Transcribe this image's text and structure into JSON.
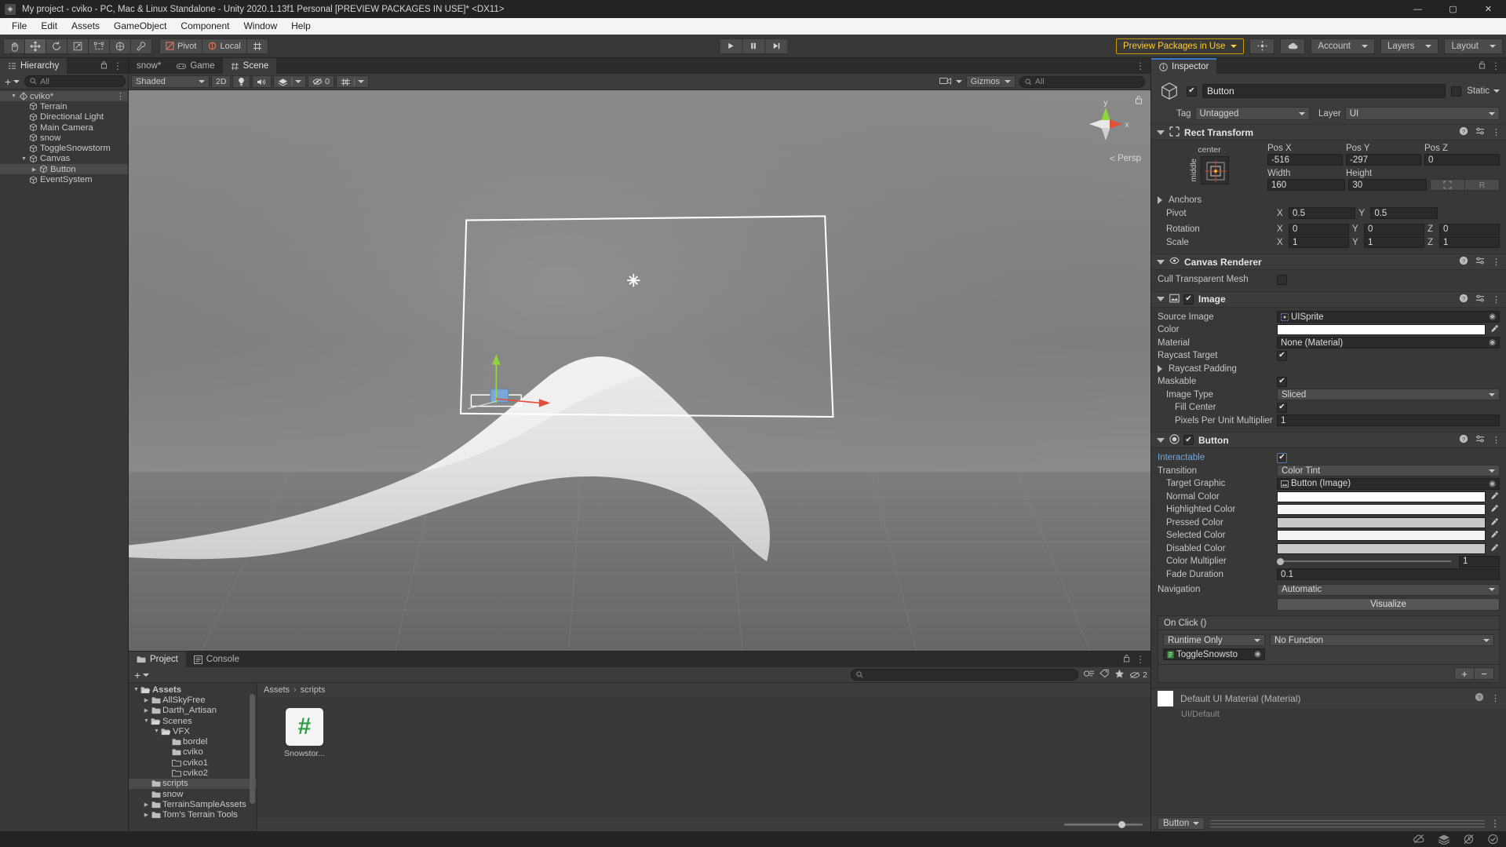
{
  "window": {
    "title": "My project - cviko - PC, Mac & Linux Standalone - Unity 2020.1.13f1 Personal [PREVIEW PACKAGES IN USE]* <DX11>",
    "minimize": "—",
    "maximize": "▢",
    "close": "✕"
  },
  "menubar": {
    "items": [
      "File",
      "Edit",
      "Assets",
      "GameObject",
      "Component",
      "Window",
      "Help"
    ]
  },
  "toolbar": {
    "tools": [
      {
        "name": "hand-tool",
        "glyph": "✋"
      },
      {
        "name": "move-tool",
        "glyph": "✥"
      },
      {
        "name": "rotate-tool",
        "glyph": "↻"
      },
      {
        "name": "scale-tool",
        "glyph": "⤢"
      },
      {
        "name": "rect-tool",
        "glyph": "▢"
      },
      {
        "name": "transform-tool",
        "glyph": "✦"
      },
      {
        "name": "custom-editor-tool",
        "glyph": "🔧"
      }
    ],
    "pivot_label": "Pivot",
    "handle_label": "Local",
    "grid_label": "#",
    "play": "▶",
    "pause": "❚❚",
    "step": "▶❙",
    "preview_packages": "Preview Packages in Use",
    "account": "Account",
    "layers": "Layers",
    "layout": "Layout"
  },
  "hierarchy": {
    "tab_label": "Hierarchy",
    "search_placeholder": "All",
    "plus_label": "+",
    "items": [
      {
        "label": "cviko*",
        "depth": 0,
        "expanded": true,
        "selected": true,
        "icon": "unity-scene-icon"
      },
      {
        "label": "Terrain",
        "depth": 1,
        "expanded": null,
        "selected": false,
        "icon": "gameobject-icon"
      },
      {
        "label": "Directional Light",
        "depth": 1,
        "expanded": null,
        "selected": false,
        "icon": "gameobject-icon"
      },
      {
        "label": "Main Camera",
        "depth": 1,
        "expanded": null,
        "selected": false,
        "icon": "gameobject-icon"
      },
      {
        "label": "snow",
        "depth": 1,
        "expanded": null,
        "selected": false,
        "icon": "gameobject-icon"
      },
      {
        "label": "ToggleSnowstorm",
        "depth": 1,
        "expanded": null,
        "selected": false,
        "icon": "gameobject-icon"
      },
      {
        "label": "Canvas",
        "depth": 1,
        "expanded": true,
        "selected": false,
        "icon": "gameobject-icon"
      },
      {
        "label": "Button",
        "depth": 2,
        "expanded": false,
        "selected": true,
        "icon": "gameobject-icon"
      },
      {
        "label": "EventSystem",
        "depth": 1,
        "expanded": null,
        "selected": false,
        "icon": "gameobject-icon"
      }
    ]
  },
  "scene": {
    "tabs": [
      {
        "label": "snow*",
        "active": false,
        "icon": ""
      },
      {
        "label": "Game",
        "active": false,
        "icon": "gamepad-icon"
      },
      {
        "label": "Scene",
        "active": true,
        "icon": "grid-icon"
      }
    ],
    "draw_mode": "Shaded",
    "two_d": "2D",
    "lighting_icon": "lightbulb-icon",
    "audio_icon": "speaker-icon",
    "fx_icon": "fx-icon",
    "hidden_count": "0",
    "gizmos_label": "Gizmos",
    "search_placeholder": "All",
    "persp_label": "Persp",
    "axis_x": "x",
    "axis_y": "y"
  },
  "project": {
    "tabs": [
      {
        "label": "Project",
        "active": true,
        "icon": "folder-icon"
      },
      {
        "label": "Console",
        "active": false,
        "icon": "console-icon"
      }
    ],
    "search_placeholder": "",
    "badge_count": "2",
    "breadcrumb": [
      "Assets",
      "scripts"
    ],
    "tree": [
      {
        "label": "Assets",
        "depth": 0,
        "expanded": true,
        "selected": false,
        "type": "folder-open"
      },
      {
        "label": "AllSkyFree",
        "depth": 1,
        "expanded": false,
        "selected": false,
        "type": "folder"
      },
      {
        "label": "Darth_Artisan",
        "depth": 1,
        "expanded": false,
        "selected": false,
        "type": "folder"
      },
      {
        "label": "Scenes",
        "depth": 1,
        "expanded": true,
        "selected": false,
        "type": "folder-open"
      },
      {
        "label": "VFX",
        "depth": 2,
        "expanded": true,
        "selected": false,
        "type": "folder-open"
      },
      {
        "label": "bordel",
        "depth": 3,
        "expanded": null,
        "selected": false,
        "type": "folder"
      },
      {
        "label": "cviko",
        "depth": 3,
        "expanded": null,
        "selected": false,
        "type": "folder"
      },
      {
        "label": "cviko1",
        "depth": 3,
        "expanded": null,
        "selected": false,
        "type": "folder-empty"
      },
      {
        "label": "cviko2",
        "depth": 3,
        "expanded": null,
        "selected": false,
        "type": "folder-empty"
      },
      {
        "label": "scripts",
        "depth": 1,
        "expanded": null,
        "selected": true,
        "type": "folder"
      },
      {
        "label": "snow",
        "depth": 1,
        "expanded": null,
        "selected": false,
        "type": "folder"
      },
      {
        "label": "TerrainSampleAssets",
        "depth": 1,
        "expanded": false,
        "selected": false,
        "type": "folder"
      },
      {
        "label": "Tom's Terrain Tools",
        "depth": 1,
        "expanded": false,
        "selected": false,
        "type": "folder"
      }
    ],
    "assets": [
      {
        "label": "Snowstor...",
        "glyph": "#",
        "color": "#2f9e44"
      }
    ]
  },
  "inspector": {
    "tab_label": "Inspector",
    "object_name": "Button",
    "enabled": true,
    "static_label": "Static",
    "tag_label": "Tag",
    "tag_value": "Untagged",
    "layer_label": "Layer",
    "layer_value": "UI",
    "rect_transform": {
      "title": "Rect Transform",
      "anchor_preset_top": "center",
      "anchor_preset_side": "middle",
      "pos_x_label": "Pos X",
      "pos_x": "-516",
      "pos_y_label": "Pos Y",
      "pos_y": "-297",
      "pos_z_label": "Pos Z",
      "pos_z": "0",
      "width_label": "Width",
      "width": "160",
      "height_label": "Height",
      "height": "30",
      "blueprint_btn": "▦",
      "raw_btn": "R",
      "anchors_label": "Anchors",
      "pivot_label": "Pivot",
      "pivot_x": "0.5",
      "pivot_y": "0.5",
      "rotation_label": "Rotation",
      "rot_x": "0",
      "rot_y": "0",
      "rot_z": "0",
      "scale_label": "Scale",
      "scale_x": "1",
      "scale_y": "1",
      "scale_z": "1"
    },
    "canvas_renderer": {
      "title": "Canvas Renderer",
      "cull_label": "Cull Transparent Mesh",
      "cull_checked": false
    },
    "image": {
      "title": "Image",
      "enabled": true,
      "source_image_label": "Source Image",
      "source_image_value": "UISprite",
      "color_label": "Color",
      "color_value": "#ffffff",
      "material_label": "Material",
      "material_value": "None (Material)",
      "raycast_target_label": "Raycast Target",
      "raycast_target": true,
      "raycast_padding_label": "Raycast Padding",
      "maskable_label": "Maskable",
      "maskable": true,
      "image_type_label": "Image Type",
      "image_type_value": "Sliced",
      "fill_center_label": "Fill Center",
      "fill_center": true,
      "ppu_label": "Pixels Per Unit Multiplier",
      "ppu_value": "1"
    },
    "button": {
      "title": "Button",
      "enabled": true,
      "interactable_label": "Interactable",
      "interactable": true,
      "transition_label": "Transition",
      "transition_value": "Color Tint",
      "target_graphic_label": "Target Graphic",
      "target_graphic_value": "Button (Image)",
      "normal_color_label": "Normal Color",
      "normal_color": "#ffffff",
      "highlighted_color_label": "Highlighted Color",
      "highlighted_color": "#f5f5f5",
      "pressed_color_label": "Pressed Color",
      "pressed_color": "#c8c8c8",
      "selected_color_label": "Selected Color",
      "selected_color": "#f5f5f5",
      "disabled_color_label": "Disabled Color",
      "disabled_color": "#c8c8c8",
      "color_multiplier_label": "Color Multiplier",
      "color_multiplier": "1",
      "fade_duration_label": "Fade Duration",
      "fade_duration": "0.1",
      "navigation_label": "Navigation",
      "navigation_value": "Automatic",
      "visualize_label": "Visualize",
      "onclick_title": "On Click ()",
      "onclick_mode": "Runtime Only",
      "onclick_function": "No Function",
      "onclick_object": "ToggleSnowsto",
      "add_btn": "+",
      "remove_btn": "−"
    },
    "material": {
      "title": "Default UI Material (Material)",
      "shader_line": "UI/Default"
    },
    "footer_dropdown": "Button"
  },
  "statusbar": {
    "icons": [
      "no-collab-icon",
      "layers-status-icon",
      "no-sync-icon",
      "check-icon"
    ]
  },
  "colors": {
    "accent": "#ffcc33",
    "panel_bg": "#383838",
    "header_bg": "#3c3c3c",
    "dark_bg": "#232323",
    "field_bg": "#2a2a2a",
    "selection": "#4a4a4a",
    "tab_active": "#3c3c3c"
  }
}
